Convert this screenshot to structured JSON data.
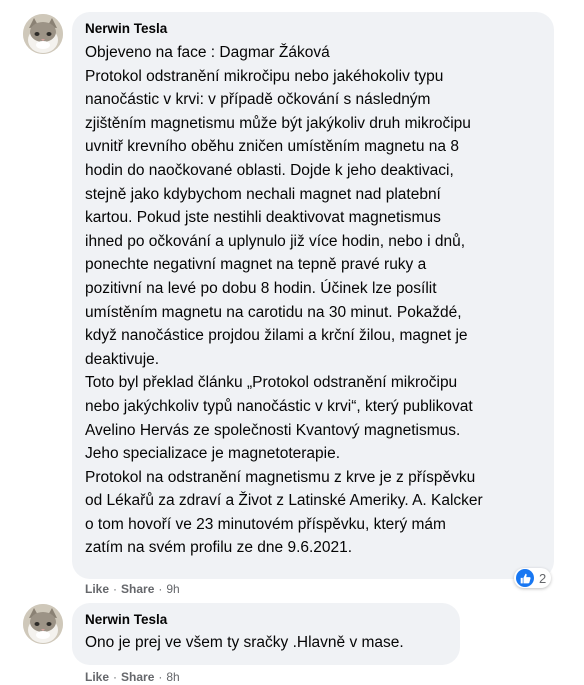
{
  "comments": [
    {
      "author": "Nerwin Tesla",
      "lines": [
        "Objeveno na face : Dagmar Žáková",
        "Protokol odstranění mikročipu nebo jakéhokoliv typu",
        "nanočástic v krvi: v případě očkování s následným",
        "zjištěním magnetismu může být jakýkoliv druh mikročipu",
        "uvnitř krevního oběhu zničen umístěním magnetu na 8",
        "hodin do naočkované oblasti. Dojde k jeho deaktivaci,",
        "stejně jako kdybychom nechali magnet nad platební",
        "kartou. Pokud jste nestihli deaktivovat magnetismus",
        "ihned po očkování a uplynulo již více hodin, nebo i dnů,",
        "ponechte negativní magnet na tepně pravé ruky a",
        "pozitivní na levé po dobu 8 hodin. Účinek lze posílit",
        "umístěním magnetu na carotidu na 30 minut. Pokaždé,",
        "když nanočástice projdou žilami a krční žilou, magnet je",
        "deaktivuje.",
        "Toto byl překlad článku „Protokol odstranění mikročipu",
        "nebo jakýchkoliv typů nanočástic v krvi“, který publikovat",
        "Avelino Hervás ze společnosti Kvantový magnetismus.",
        "Jeho specializace je magnetoterapie.",
        "Protokol na odstranění magnetismu z krve je z příspěvku",
        "od Lékařů za zdraví a Život z Latinské Ameriky. A. Kalcker",
        "o tom hovoří ve 23 minutovém příspěvku, který mám",
        "zatím na svém profilu ze dne 9.6.2021."
      ],
      "like_label": "Like",
      "share_label": "Share",
      "time": "9h",
      "reaction_count": "2"
    },
    {
      "author": "Nerwin Tesla",
      "lines": [
        "Ono je prej ve všem ty sračky .Hlavně v mase."
      ],
      "like_label": "Like",
      "share_label": "Share",
      "time": "8h"
    }
  ],
  "colors": {
    "bubble": "#f0f2f5",
    "meta_text": "#65676b",
    "like_blue": "#1877f2"
  }
}
